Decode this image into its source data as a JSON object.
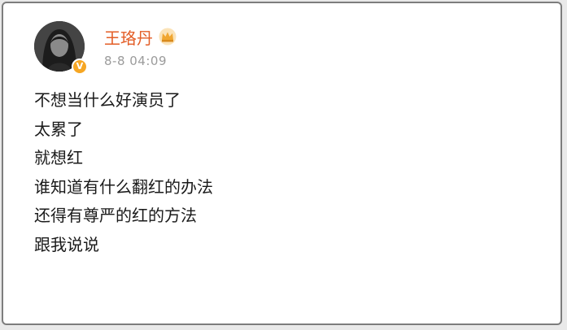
{
  "post": {
    "author": {
      "name": "王珞丹",
      "verified_badge": "V",
      "crown_icon": "crown-icon",
      "avatar_icon": "avatar-icon"
    },
    "timestamp": "8-8 04:09",
    "lines": [
      "不想当什么好演员了",
      "太累了",
      "就想红",
      "谁知道有什么翻红的办法",
      "还得有尊严的红的方法",
      "跟我说说"
    ]
  },
  "colors": {
    "username": "#e35d26",
    "timestamp": "#9b9b9b",
    "verified_badge": "#f6a623",
    "crown": "#f0a631",
    "text": "#1a1a1a",
    "border": "#7d7d7d"
  }
}
